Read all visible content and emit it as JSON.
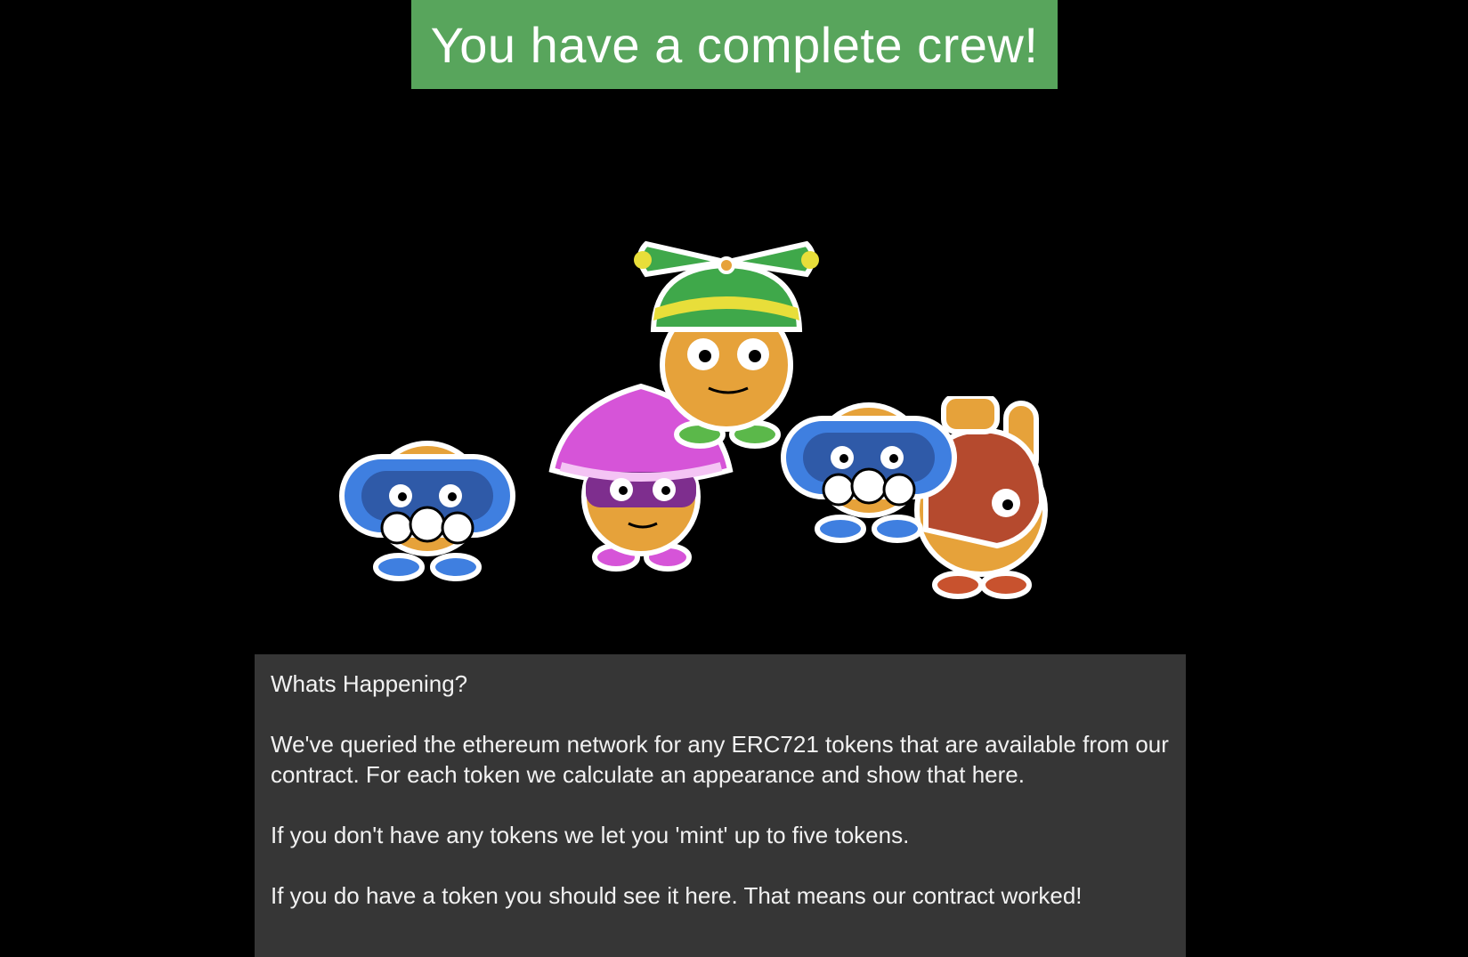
{
  "banner": {
    "text": "You have a complete crew!",
    "color": "#58a55c"
  },
  "crew": {
    "members": [
      {
        "hat": "propeller-beanie",
        "hat_color": "#3fa84a",
        "band_color": "#e8de3a",
        "skin": "#e6a23a",
        "feet": "#5bb84a"
      },
      {
        "hat": "mushroom-cap",
        "hat_color": "#d654d8",
        "band_color": "#7e2e8e",
        "skin": "#e6a23a",
        "feet": "#d654d8"
      },
      {
        "hat": "goggles-mustache",
        "hat_color": "#3f7fe0",
        "band_color": "#2f5aa8",
        "skin": "#e6a23a",
        "feet": "#3f7fe0"
      },
      {
        "hat": "goggles-mustache",
        "hat_color": "#3f7fe0",
        "band_color": "#2f5aa8",
        "skin": "#e6a23a",
        "feet": "#3f7fe0"
      },
      {
        "hat": "helmet",
        "hat_color": "#b54a2e",
        "band_color": "#e6a23a",
        "skin": "#e6a23a",
        "feet": "#c8522e"
      }
    ]
  },
  "info": {
    "heading": "Whats Happening?",
    "paragraph_1": "We've queried the ethereum network for any ERC721 tokens that are available from our contract. For each token we calculate an appearance and show that here.",
    "paragraph_2": "If you don't have any tokens we let you 'mint' up to five tokens.",
    "paragraph_3": "If you do have a token you should see it here. That means our contract worked!"
  }
}
